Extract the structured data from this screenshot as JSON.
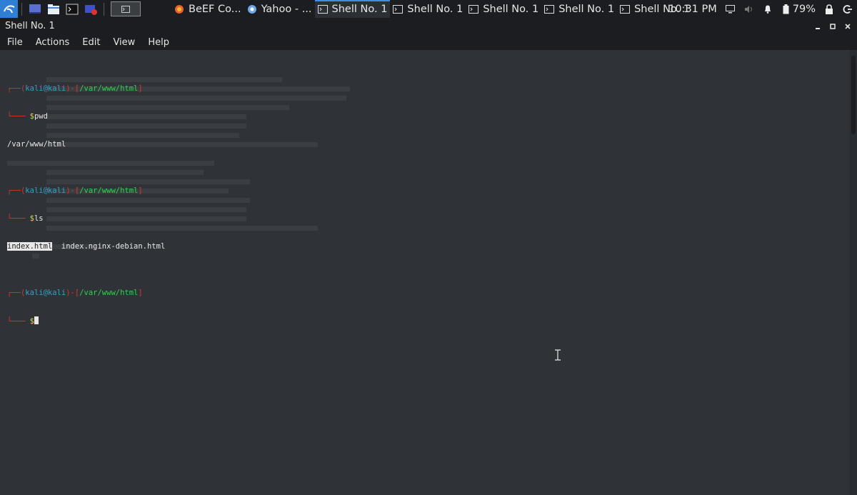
{
  "taskbar": {
    "tasks": [
      {
        "label": "BeEF Co...",
        "icon": "firefox-icon"
      },
      {
        "label": "Yahoo - ...",
        "icon": "chromium-icon"
      },
      {
        "label": "Shell No. 1",
        "icon": "terminal-icon",
        "active": true
      },
      {
        "label": "Shell No. 1",
        "icon": "terminal-icon"
      },
      {
        "label": "Shell No. 1",
        "icon": "terminal-icon"
      },
      {
        "label": "Shell No. 1",
        "icon": "terminal-icon"
      },
      {
        "label": "Shell No. 1",
        "icon": "terminal-icon"
      }
    ],
    "clock": "10:31 PM",
    "battery": "79%"
  },
  "window": {
    "title": "Shell No. 1",
    "controls": [
      "minimize",
      "maximize",
      "close"
    ]
  },
  "menu": {
    "items": [
      "File",
      "Actions",
      "Edit",
      "View",
      "Help"
    ]
  },
  "terminal": {
    "prompt_user": "kali",
    "prompt_at": "@",
    "prompt_host": "kali",
    "prompt_dir": "/var/www/html",
    "prompt_sym": "$",
    "cmd1": "pwd",
    "out1": "/var/www/html",
    "cmd2": "ls",
    "ls_file1": "index.html",
    "ls_file2": "index.nginx-debian.html"
  },
  "colors": {
    "background": "#2f3337",
    "prompt_red": "#e0302d",
    "prompt_cyan": "#2ea2c7",
    "prompt_green": "#27d64a",
    "dollar_yellow": "#f5c84a",
    "panel": "#1b1d21",
    "active_accent": "#3d8ee8"
  }
}
